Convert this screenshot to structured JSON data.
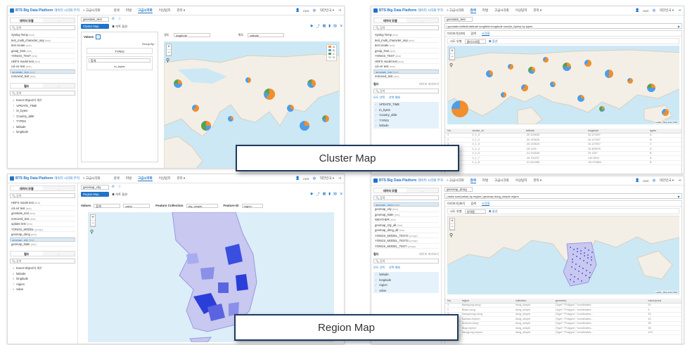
{
  "app": {
    "logo": "BTS Big Data Platform",
    "logo_sub": "데이터 시각화 무지",
    "breadcrumb": "> 고급시각화",
    "nav": [
      "검색",
      "피벗",
      "고급시각화",
      "이상탐지",
      "관리 ▾"
    ],
    "active_nav": "고급시각화",
    "user": "root",
    "lang": "대한민국 ▾"
  },
  "captions": {
    "cluster": "Cluster Map",
    "region": "Region Map"
  },
  "s1": {
    "subtabs": [
      "데이터 모델",
      "..."
    ],
    "search_placeholder": "검색",
    "models": [
      {
        "name": "Syslog Temp",
        "tag": "(test)"
      },
      {
        "name": "test_multi_character_sep",
        "tag": "(test)"
      },
      {
        "name": "test create",
        "tag": "(test)"
      },
      {
        "name": "geoip_lmst",
        "tag": "(test)"
      },
      {
        "name": "YONGS_TEST",
        "tag": "(test)"
      },
      {
        "name": "HDFS model test",
        "tag": "(test)"
      },
      {
        "name": "col err test",
        "tag": "(test)"
      },
      {
        "name": "geostats_test",
        "tag": "(test)"
      },
      {
        "name": "removed_test",
        "tag": "(test)"
      }
    ],
    "selected_model": "geostats_test",
    "field_tabs": [
      "필드",
      "..."
    ],
    "field_search": "검색",
    "fields": [
      {
        "type": "#",
        "name": "Event Object의 개수"
      },
      {
        "type": "T",
        "name": "UPDATE_TIME"
      },
      {
        "type": "T",
        "name": "tn_bytes"
      },
      {
        "type": "T",
        "name": "Country_abbr"
      },
      {
        "type": "T",
        "name": "TYPES"
      },
      {
        "type": "#",
        "name": "latitude"
      },
      {
        "type": "#",
        "name": "longitude"
      }
    ],
    "file": "geostats_test",
    "chart_type": "Cluster Map",
    "chart_option": "◉ 차트 옵션",
    "values_label": "Values",
    "group_by_label": "Group By :",
    "types_label": "TYPES",
    "sum_label": "합계",
    "sum_field": "tn_bytes",
    "lng_label": "경도",
    "lng_value": "longitude",
    "lat_label": "위도",
    "lat_value": "latitude",
    "legend": [
      "A",
      "B",
      "C",
      "D"
    ]
  },
  "s2": {
    "subtabs": [
      "데이터 모델",
      "..."
    ],
    "search_placeholder": "검색",
    "models": [
      {
        "name": "Syslog Temp",
        "tag": "(test)"
      },
      {
        "name": "test_multi_character_sep",
        "tag": "(test)"
      },
      {
        "name": "test create",
        "tag": "(test)"
      },
      {
        "name": "geoip_lmst",
        "tag": "(test)"
      },
      {
        "name": "YONGS_TEST",
        "tag": "(test)"
      },
      {
        "name": "HDFS model test",
        "tag": "(test)"
      },
      {
        "name": "col err test",
        "tag": "(test)"
      },
      {
        "name": "geostats_test",
        "tag": "(test)"
      },
      {
        "name": "removed_test",
        "tag": "(test)"
      }
    ],
    "selected_model": "geostats_test",
    "field_head": "필드",
    "field_toggle": "데이터 미리보기",
    "field_search": "검색",
    "field_actions": [
      "모두 선택",
      "선택 해제"
    ],
    "fields": [
      "UPDATE_TIME",
      "tn_bytes",
      "Country_abbr",
      "TYPES",
      "latitude"
    ],
    "file": "geostats_test",
    "query": "| geostats latfield=latitude longfield=longitude sum(tn_bytes) by types",
    "tabs": [
      "미리보기(100)",
      "검색",
      "시각화"
    ],
    "option_label": "시도 유형",
    "option_value": "클러스터맵",
    "option_btn": "◉ 옵션",
    "table_headers": [
      "No.",
      "cluster_id",
      "latitude",
      "longitude",
      "types"
    ],
    "table_rows": [
      [
        "1",
        "0_1_3",
        "-30.153628",
        "34.127807",
        "A"
      ],
      [
        "2",
        "0_1_3",
        "-30.153628",
        "34.127807",
        "B"
      ],
      [
        "3",
        "0_1_3",
        "-30.153628",
        "34.127807",
        "C"
      ],
      [
        "4",
        "0_1_4",
        "-28.1339",
        "18.383876",
        "A"
      ],
      [
        "5",
        "0_1_5",
        "-31.153628",
        "29.1287",
        "B"
      ],
      [
        "6",
        "0_1_7",
        "-35.700237",
        "149.9803",
        "A"
      ],
      [
        "7",
        "0_1_8",
        "-21.641585",
        "-60.976804",
        "B"
      ]
    ],
    "attribution": "Leaflet | Map data OSM"
  },
  "s3": {
    "subtabs": [
      "데이터 모델",
      "..."
    ],
    "search_placeholder": "검색",
    "models": [
      {
        "name": "HDFS model test",
        "tag": "(test)"
      },
      {
        "name": "col err test",
        "tag": "(test)"
      },
      {
        "name": "geostats_test",
        "tag": "(test)"
      },
      {
        "name": "removed_test",
        "tag": "(test)"
      },
      {
        "name": "update test",
        "tag": "(test)"
      },
      {
        "name": "YONGS_MODEL",
        "tag": "(yongs)"
      },
      {
        "name": "geomap_dong",
        "tag": "(test)"
      },
      {
        "name": "geomap_city",
        "tag": "(test)"
      },
      {
        "name": "geomap_state",
        "tag": "(test)"
      }
    ],
    "selected_model": "geomap_city",
    "field_tabs": [
      "필드",
      "..."
    ],
    "field_search": "검색",
    "fields": [
      {
        "type": "#",
        "name": "Event Object의 개수"
      },
      {
        "type": "#",
        "name": "latitude"
      },
      {
        "type": "#",
        "name": "longitude"
      },
      {
        "type": "T",
        "name": "region"
      },
      {
        "type": "#",
        "name": "value"
      }
    ],
    "file": "geomap_city",
    "chart_type": "Region Map",
    "chart_option": "◉ 차트 옵션",
    "values_label": "Values",
    "agg": "합계",
    "agg_field": "value",
    "feature_collection_label": "Feature Collection",
    "feature_collection_value": "city_simple",
    "feature_id_label": "Feature ID",
    "feature_id_value": "region"
  },
  "s4": {
    "subtabs": [
      "데이터 모델",
      "..."
    ],
    "search_placeholder": "검색",
    "models": [
      {
        "name": "geomap_dong",
        "tag": "(test)"
      },
      {
        "name": "geomap_city",
        "tag": "(test)"
      },
      {
        "name": "geomap_state",
        "tag": "(test)"
      },
      {
        "name": "WEATHER",
        "tag": "(test)"
      },
      {
        "name": "geomap_city_all",
        "tag": "(test)"
      },
      {
        "name": "geomap_dong_all",
        "tag": "(test)"
      },
      {
        "name": "YONGS_MODEL_TEST2",
        "tag": "(yongs)"
      },
      {
        "name": "YONGS_MODEL_TEST3",
        "tag": "(yongs)"
      },
      {
        "name": "YONGS_MODEL_TEST",
        "tag": "(yongs)"
      }
    ],
    "selected_model": "geomap_dong",
    "field_head": "필드",
    "field_toggle": "데이터 미리보기",
    "field_search": "검색",
    "field_actions": [
      "모두 선택",
      "선택 해제"
    ],
    "fields": [
      "latitude",
      "longitude",
      "region",
      "value"
    ],
    "file": "geomap_dong",
    "query": "| stats sum(value) by region | geomap dong_simple region",
    "tabs": [
      "미리보기(357)",
      "검색",
      "시각화"
    ],
    "option_label": "시도 유형",
    "option_value": "지역맵",
    "option_btn": "◉ 옵션",
    "table_headers": [
      "No.",
      "region",
      "collection",
      "geometry",
      "value(sum)"
    ],
    "table_rows": [
      [
        "1",
        "Baekgung-dong",
        "dong_simple",
        "{\"type\":\"Polygon\",\"coordinates...",
        "31"
      ],
      [
        "2",
        "Bisan-dong",
        "dong_simple",
        "{\"type\":\"Polygon\",\"coordinates...",
        "9"
      ],
      [
        "3",
        "Daepyeong-dong",
        "dong_simple",
        "{\"type\":\"Polygon\",\"coordinates...",
        "35"
      ],
      [
        "4",
        "Daesan-myeon",
        "dong_simple",
        "{\"type\":\"Polygon\",\"coordinates...",
        "44"
      ],
      [
        "5",
        "Anseom-dong",
        "dong_simple",
        "{\"type\":\"Polygon\",\"coordinates...",
        "38"
      ],
      [
        "6",
        "Bugi-myeon",
        "dong_simple",
        "{\"type\":\"Polygon\",\"coordinates...",
        "58"
      ],
      [
        "7",
        "Bangyong-myeon",
        "dong_simple",
        "{\"type\":\"Polygon\",\"coordinates...",
        "104"
      ]
    ],
    "attribution": "Leaflet | Map data OSM"
  }
}
